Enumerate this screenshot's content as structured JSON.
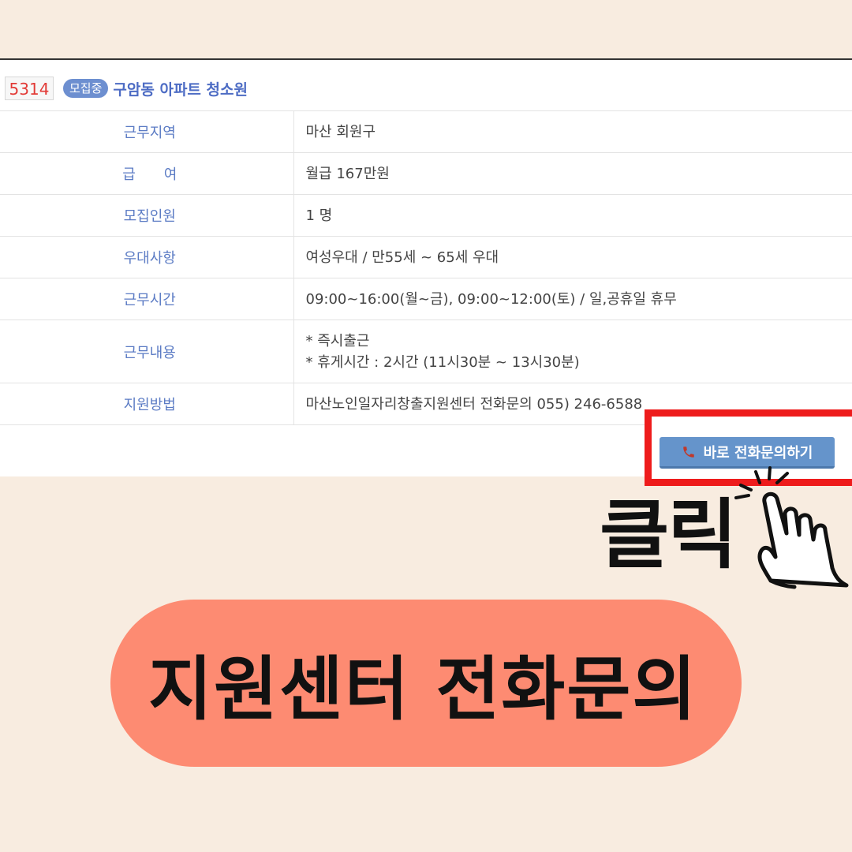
{
  "job": {
    "id": "5314",
    "status_badge": "모집중",
    "title": "구암동 아파트 청소원"
  },
  "table": {
    "rows": [
      {
        "label": "근무지역",
        "lines": [
          "마산 회원구"
        ]
      },
      {
        "label": "급　　여",
        "lines": [
          "월급 167만원"
        ]
      },
      {
        "label": "모집인원",
        "lines": [
          "1 명"
        ]
      },
      {
        "label": "우대사항",
        "lines": [
          "여성우대 / 만55세 ~ 65세 우대"
        ]
      },
      {
        "label": "근무시간",
        "lines": [
          "09:00~16:00(월~금), 09:00~12:00(토) / 일,공휴일 휴무"
        ]
      },
      {
        "label": "근무내용",
        "lines": [
          "* 즉시출근",
          "* 휴게시간 : 2시간 (11시30분 ~ 13시30분)"
        ]
      },
      {
        "label": "지원방법",
        "lines": [
          "마산노인일자리창출지원센터 전화문의 055) 246-6588"
        ]
      }
    ]
  },
  "call_button": {
    "label": "바로 전화문의하기",
    "icon": "phone-icon"
  },
  "overlay": {
    "click_text": "클릭",
    "hand_icon": "pointing-hand-icon",
    "banner_text": "지원센터 전화문의"
  },
  "colors": {
    "background": "#f8ece0",
    "highlight_border": "#ee1c1c",
    "button": "#6594cb",
    "banner": "#fd8b72",
    "label_text": "#5b7bc4",
    "job_id": "#e23a36"
  }
}
